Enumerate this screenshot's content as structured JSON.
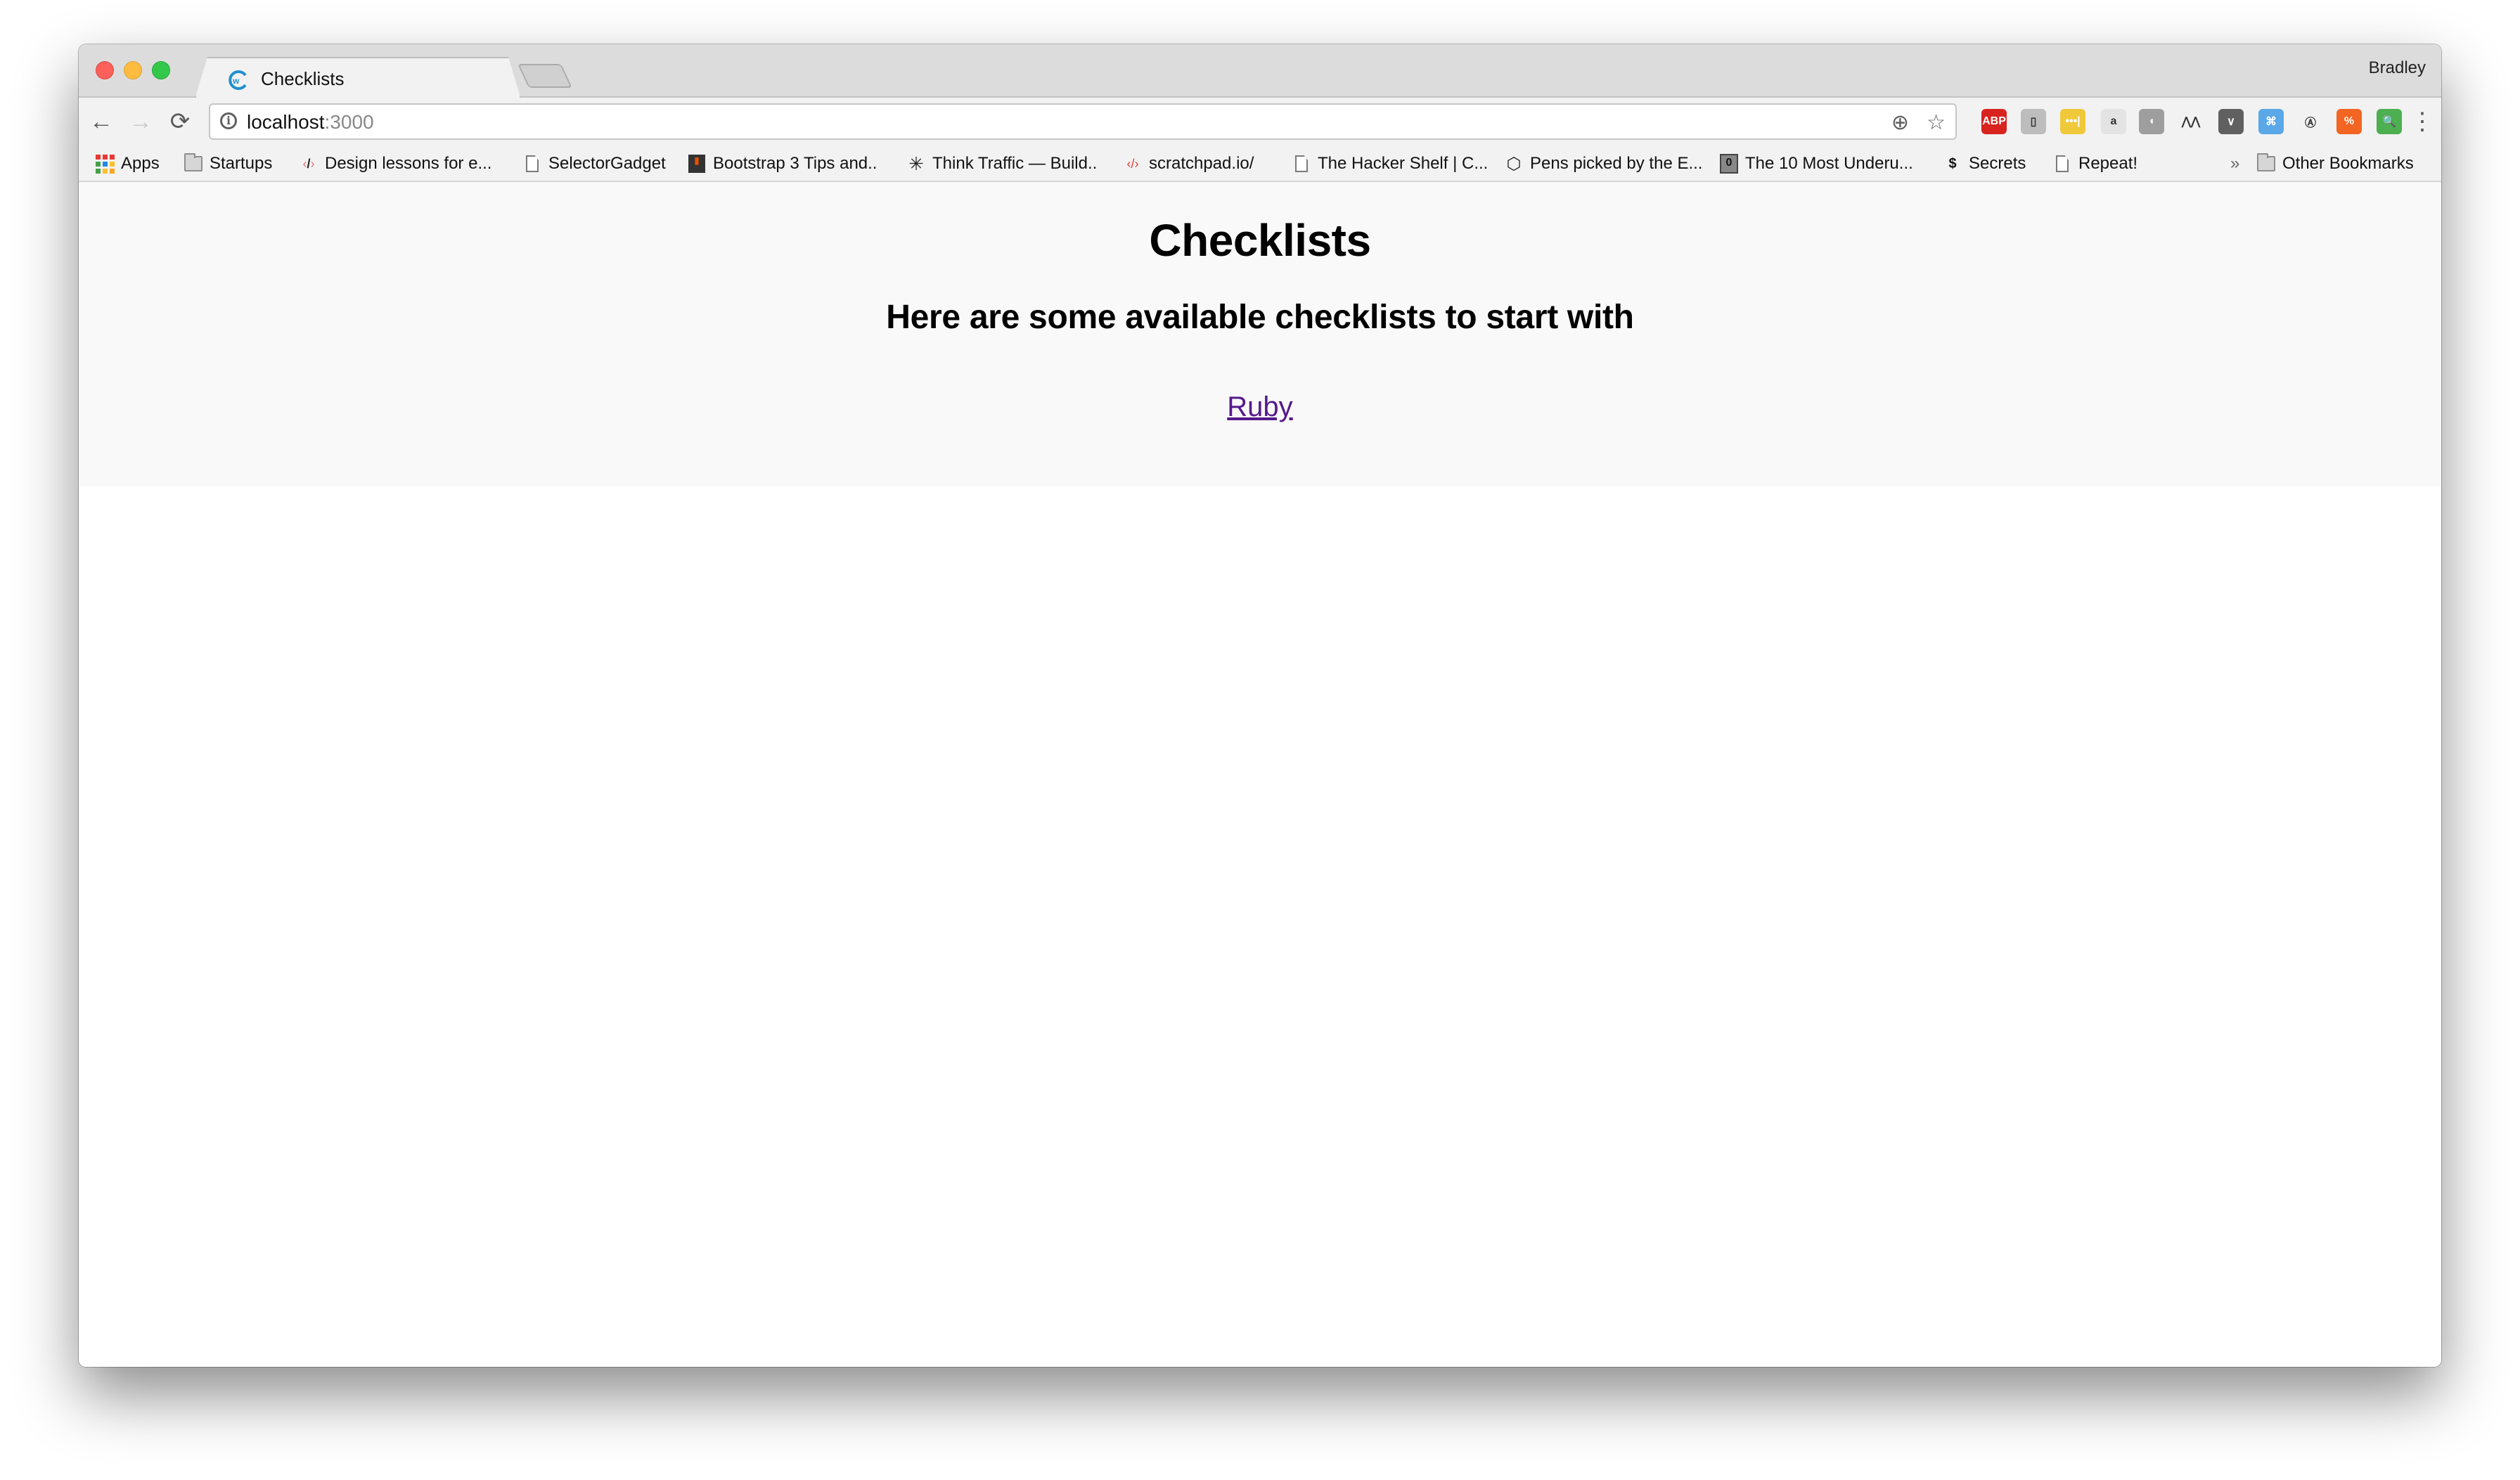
{
  "browser": {
    "tab": {
      "title": "Checklists",
      "favicon": "w-logo-icon",
      "close_label": "×"
    },
    "profile_name": "Bradley",
    "address": {
      "host": "localhost",
      "port": ":3000"
    },
    "nav": {
      "back": "←",
      "forward": "→",
      "reload": "⟳"
    },
    "omnibox_icons": {
      "zoom": "⊕",
      "star": "☆"
    },
    "extensions": [
      {
        "name": "adblock-plus-icon",
        "label": "ABP",
        "color": "#d8231f"
      },
      {
        "name": "outlet-extension-icon",
        "label": "▯",
        "color": "#bdbdbd"
      },
      {
        "name": "lastpass-icon",
        "label": "•••|",
        "color": "#f0c93a"
      },
      {
        "name": "a-chat-extension-icon",
        "label": "a",
        "color": "#e3e3e3"
      },
      {
        "name": "gray-shield-extension-icon",
        "label": "◖",
        "color": "#9e9e9e"
      },
      {
        "name": "mountain-extension-icon",
        "label": "⋀⋀",
        "color": "transparent"
      },
      {
        "name": "pocket-icon",
        "label": "∨",
        "color": "#606060"
      },
      {
        "name": "command-extension-icon",
        "label": "⌘",
        "color": "#5aa8e8"
      },
      {
        "name": "a-circle-extension-icon",
        "label": "Ⓐ",
        "color": "transparent"
      },
      {
        "name": "code-extension-icon",
        "label": "%",
        "color": "#f26522"
      },
      {
        "name": "green-search-extension-icon",
        "label": "🔍",
        "color": "#4caf50"
      }
    ],
    "menu_label": "⋮",
    "bookmarks": [
      {
        "label": "Apps",
        "icon": "apps-grid-icon"
      },
      {
        "label": "Startups",
        "icon": "folder-icon"
      },
      {
        "label": "Design lessons for e...",
        "icon": "code-pen-icon"
      },
      {
        "label": "SelectorGadget",
        "icon": "page-icon"
      },
      {
        "label": "Bootstrap 3 Tips and..",
        "icon": "bootstrap-tips-icon"
      },
      {
        "label": "Think Traffic — Build..",
        "icon": "starburst-icon"
      },
      {
        "label": "scratchpad.io/",
        "icon": "scratchpad-icon"
      },
      {
        "label": "The Hacker Shelf | C...",
        "icon": "page-icon"
      },
      {
        "label": "Pens picked by the E...",
        "icon": "codepen-icon"
      },
      {
        "label": "The 10 Most Underu...",
        "icon": "zero-badge-icon"
      },
      {
        "label": "Secrets",
        "icon": "dollar-icon"
      },
      {
        "label": "Repeat!",
        "icon": "page-icon"
      }
    ],
    "overflow_label": "»",
    "other_bookmarks": {
      "label": "Other Bookmarks",
      "icon": "folder-icon"
    }
  },
  "page": {
    "title": "Checklists",
    "subtitle": "Here are some available checklists to start with",
    "links": [
      {
        "label": "Ruby"
      }
    ],
    "link_color": "#551a8b"
  }
}
